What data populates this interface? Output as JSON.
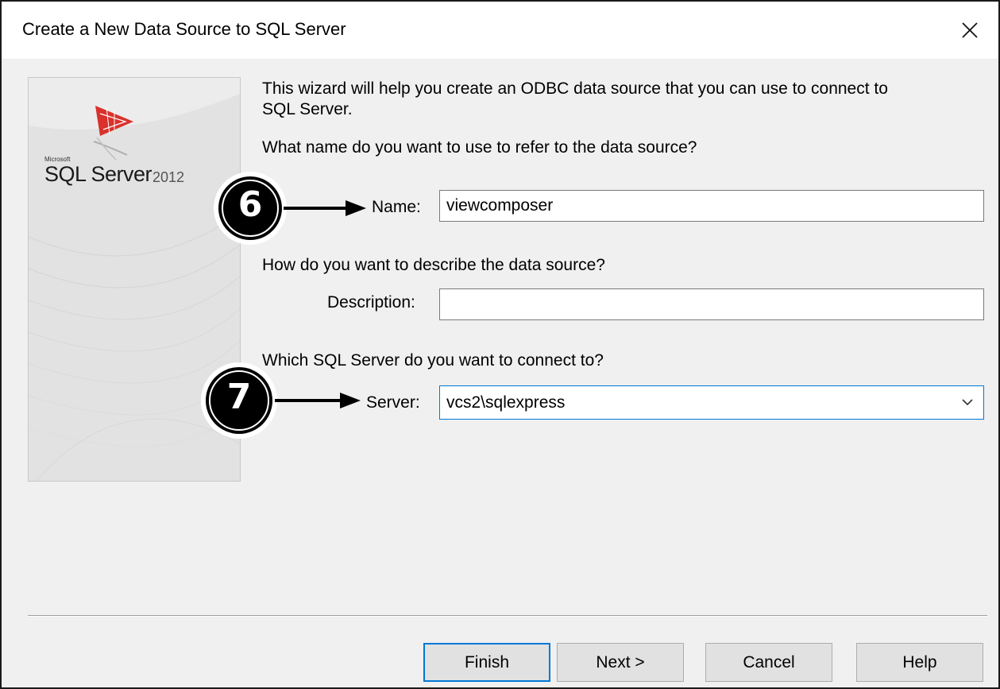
{
  "window": {
    "title": "Create a New Data Source to SQL Server",
    "close_label": "✕"
  },
  "logo": {
    "brand": "Microsoft",
    "product": "SQL Server",
    "version": "2012"
  },
  "intro": {
    "line1": "This wizard will help you create an ODBC data source that you can use to connect to",
    "line2": "SQL Server."
  },
  "name_section": {
    "question": "What name do you want to use to refer to the data source?",
    "label": "Name:",
    "value": "viewcomposer"
  },
  "description_section": {
    "question": "How do you want to describe the data source?",
    "label": "Description:",
    "value": ""
  },
  "server_section": {
    "question": "Which SQL Server do you want to connect to?",
    "label": "Server:",
    "value": "vcs2\\sqlexpress"
  },
  "buttons": {
    "finish": "Finish",
    "next": "Next >",
    "cancel": "Cancel",
    "help": "Help"
  },
  "annotations": {
    "step6": "6",
    "step7": "7"
  },
  "colors": {
    "accent": "#0078d7",
    "dialog_bg": "#f0f0f0",
    "logo_red": "#d9312b"
  },
  "icons": {
    "close": "close-icon",
    "dropdown": "chevron-down-icon",
    "logo": "sql-server-logo-icon"
  }
}
